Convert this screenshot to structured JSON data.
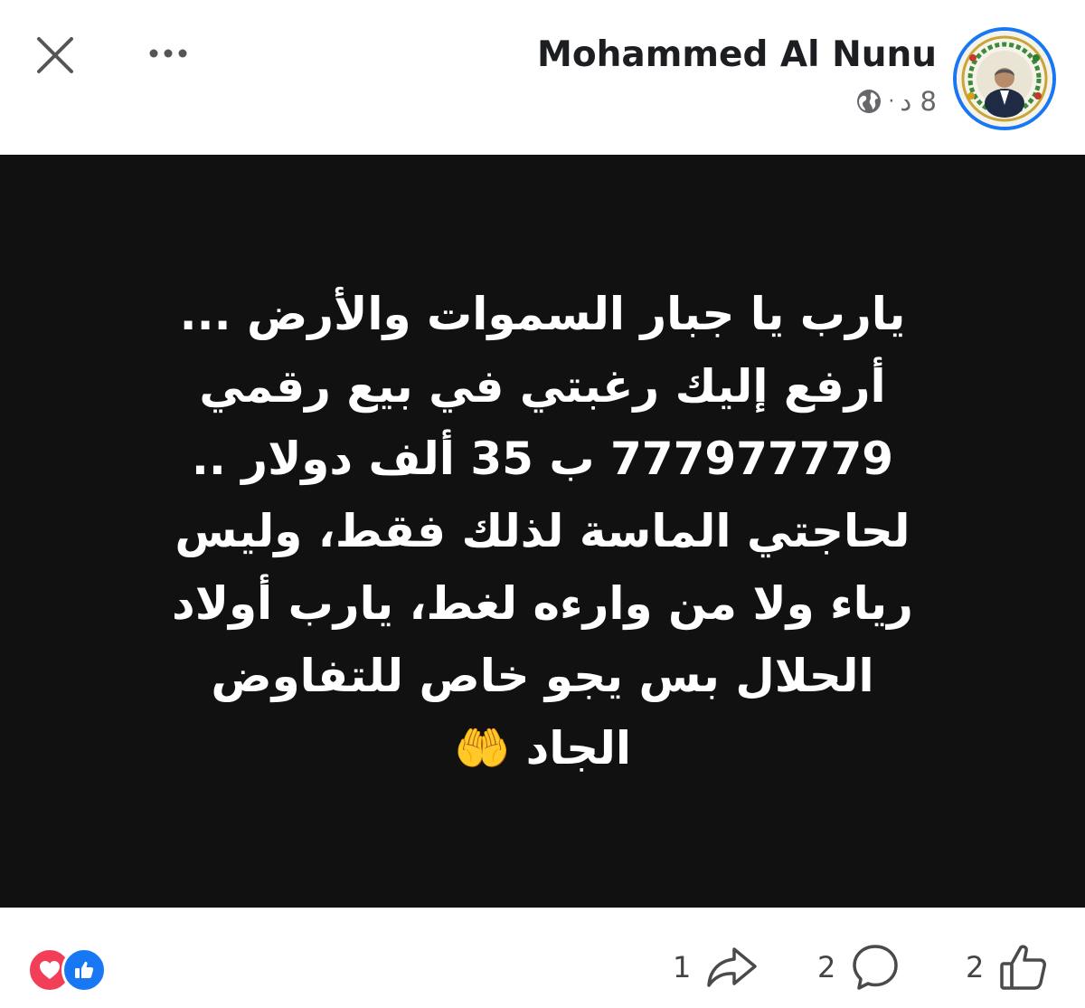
{
  "header": {
    "author_name": "Mohammed Al Nunu",
    "time_ago": "8 د",
    "separator": "·",
    "audience_icon": "globe-icon"
  },
  "toolbar": {
    "close_icon": "close-icon",
    "more_icon": "more-icon"
  },
  "post": {
    "background_color": "#111111",
    "text_color": "#ffffff",
    "lines": [
      "يارب يا جبار السموات والأرض ...",
      "أرفع إليك رغبتي في بيع رقمي",
      "777977779 ب 35 ألف دولار ..",
      "لحاجتي الماسة لذلك فقط، وليس",
      "رياء ولا من وارءه لغط، يارب أولاد",
      "الحلال بس يجو خاص للتفاوض",
      "الجاد 🤲"
    ]
  },
  "footer": {
    "reactions": [
      "love",
      "like"
    ],
    "share_count": "1",
    "comment_count": "2",
    "like_count": "2"
  },
  "colors": {
    "accent": "#1877f2",
    "love": "#f33e58",
    "muted": "#65676b"
  }
}
